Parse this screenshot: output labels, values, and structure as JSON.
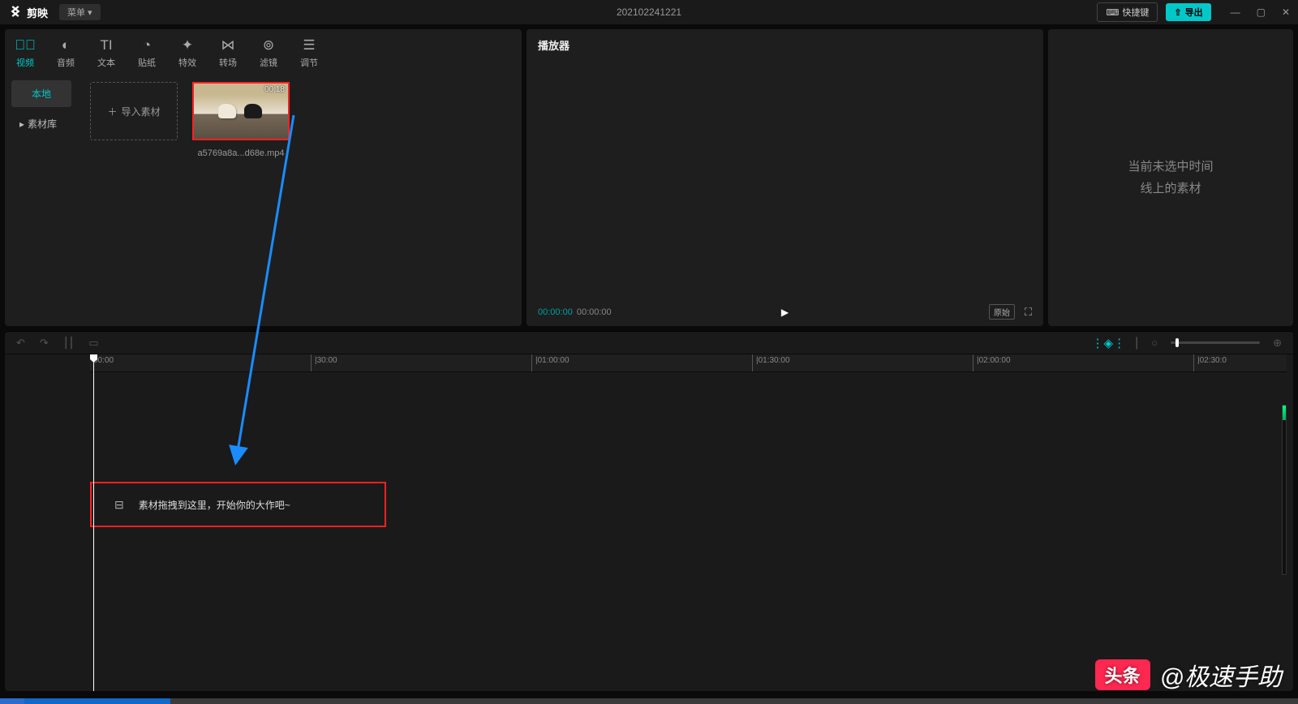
{
  "titlebar": {
    "app_name": "剪映",
    "menu_label": "菜单",
    "project_title": "202102241221",
    "shortcut_label": "快捷键",
    "export_label": "导出"
  },
  "tabs": [
    {
      "label": "视频",
      "active": true,
      "icon": "video"
    },
    {
      "label": "音频",
      "active": false,
      "icon": "audio"
    },
    {
      "label": "文本",
      "active": false,
      "icon": "text"
    },
    {
      "label": "贴纸",
      "active": false,
      "icon": "sticker"
    },
    {
      "label": "特效",
      "active": false,
      "icon": "effect"
    },
    {
      "label": "转场",
      "active": false,
      "icon": "transition"
    },
    {
      "label": "滤镜",
      "active": false,
      "icon": "filter"
    },
    {
      "label": "调节",
      "active": false,
      "icon": "adjust"
    }
  ],
  "media_sidebar": {
    "local": "本地",
    "library": "素材库"
  },
  "media": {
    "import_label": "导入素材",
    "items": [
      {
        "filename": "a5769a8a...d68e.mp4",
        "duration": "00:18"
      }
    ]
  },
  "player": {
    "title": "播放器",
    "time_current": "00:00:00",
    "time_total": "00:00:00",
    "original_label": "原始"
  },
  "props": {
    "placeholder_line1": "当前未选中时间",
    "placeholder_line2": "线上的素材"
  },
  "timeline": {
    "ruler": [
      "00:00",
      "|30:00",
      "|01:00:00",
      "|01:30:00",
      "|02:00:00",
      "|02:30:0"
    ],
    "drop_hint": "素材拖拽到这里，开始你的大作吧~"
  },
  "watermark": {
    "badge": "头条",
    "handle": "@极速手助"
  }
}
